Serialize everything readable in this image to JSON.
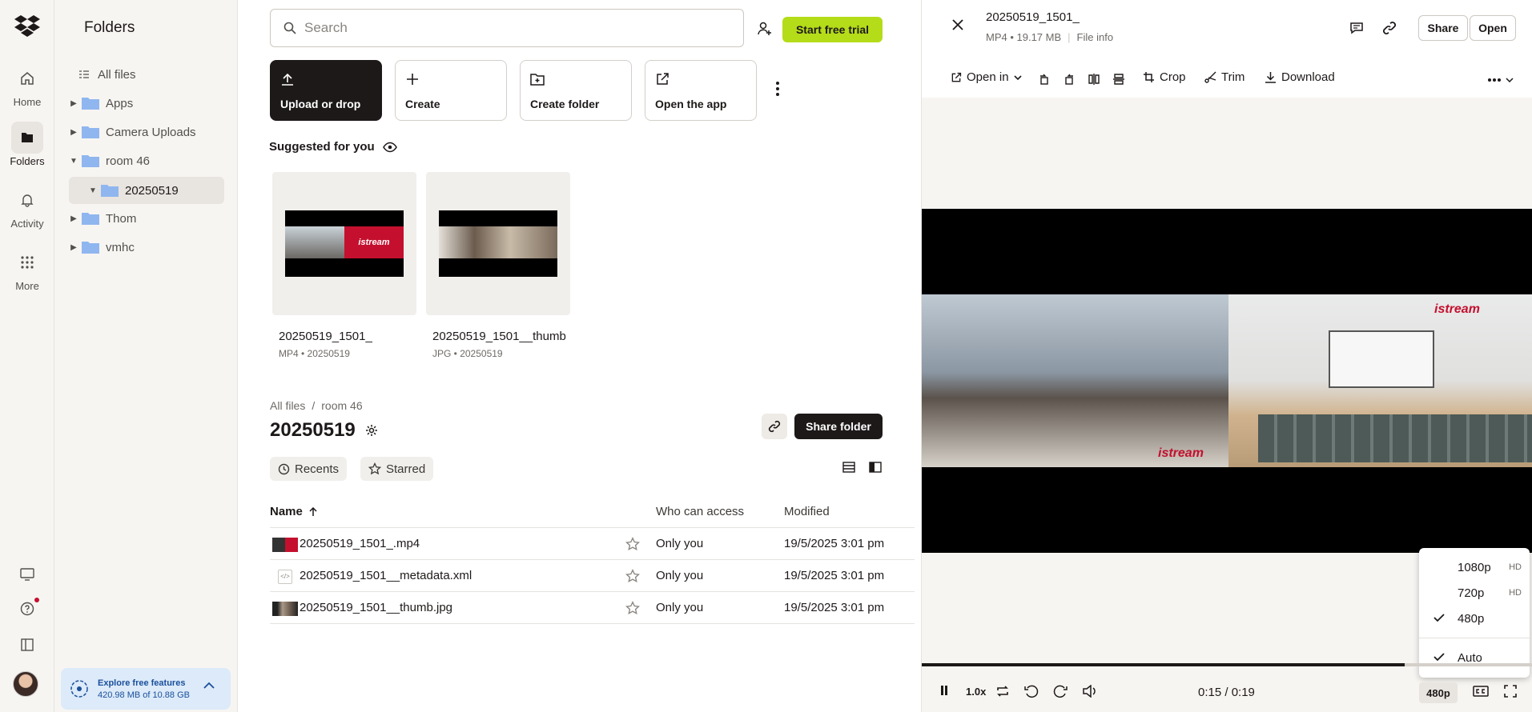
{
  "rail": {
    "items": [
      {
        "label": "Home",
        "icon": "home-icon"
      },
      {
        "label": "Folders",
        "icon": "folder-icon"
      },
      {
        "label": "Activity",
        "icon": "bell-icon"
      },
      {
        "label": "More",
        "icon": "grid-icon"
      }
    ]
  },
  "tree": {
    "title": "Folders",
    "items": [
      {
        "label": "All files"
      },
      {
        "label": "Apps"
      },
      {
        "label": "Camera Uploads"
      },
      {
        "label": "room 46"
      },
      {
        "label": "20250519"
      },
      {
        "label": "Thom"
      },
      {
        "label": "vmhc"
      }
    ],
    "upsell": {
      "title": "Explore free features",
      "usage": "420.98 MB of 10.88 GB"
    }
  },
  "main": {
    "search_placeholder": "Search",
    "trial_button": "Start free trial",
    "cards": [
      {
        "label": "Upload or drop"
      },
      {
        "label": "Create"
      },
      {
        "label": "Create folder"
      },
      {
        "label": "Open the app"
      }
    ],
    "suggested_title": "Suggested for you",
    "suggested": [
      {
        "name": "20250519_1501_",
        "meta": "MP4 • 20250519"
      },
      {
        "name": "20250519_1501__thumb",
        "meta": "JPG • 20250519"
      }
    ],
    "breadcrumb": {
      "root": "All files",
      "sep": "/",
      "parent": "room 46"
    },
    "folder_title": "20250519",
    "share_folder": "Share folder",
    "filters": {
      "recents": "Recents",
      "starred": "Starred"
    },
    "columns": {
      "name": "Name",
      "access": "Who can access",
      "modified": "Modified"
    },
    "files": [
      {
        "name": "20250519_1501_.mp4",
        "access": "Only you",
        "modified": "19/5/2025 3:01 pm"
      },
      {
        "name": "20250519_1501__metadata.xml",
        "access": "Only you",
        "modified": "19/5/2025 3:01 pm"
      },
      {
        "name": "20250519_1501__thumb.jpg",
        "access": "Only you",
        "modified": "19/5/2025 3:01 pm"
      }
    ]
  },
  "preview": {
    "file_name": "20250519_1501_",
    "meta": "MP4 • 19.17 MB",
    "file_info": "File info",
    "share": "Share",
    "open": "Open",
    "tools": {
      "open_in": "Open in",
      "crop": "Crop",
      "trim": "Trim",
      "download": "Download"
    },
    "brand": "istream",
    "player": {
      "speed": "1.0x",
      "time": "0:15 / 0:19",
      "progress": 0.79,
      "quality": "480p",
      "quality_options": [
        {
          "label": "1080p",
          "tag": "HD",
          "selected": false
        },
        {
          "label": "720p",
          "tag": "HD",
          "selected": false
        },
        {
          "label": "480p",
          "tag": "",
          "selected": true
        },
        {
          "label": "Auto",
          "tag": "",
          "selected": true
        }
      ]
    }
  },
  "colors": {
    "accent": "#b4dc19",
    "dark": "#1e1919",
    "brand_red": "#c4102e",
    "folder": "#8fb6ef"
  }
}
